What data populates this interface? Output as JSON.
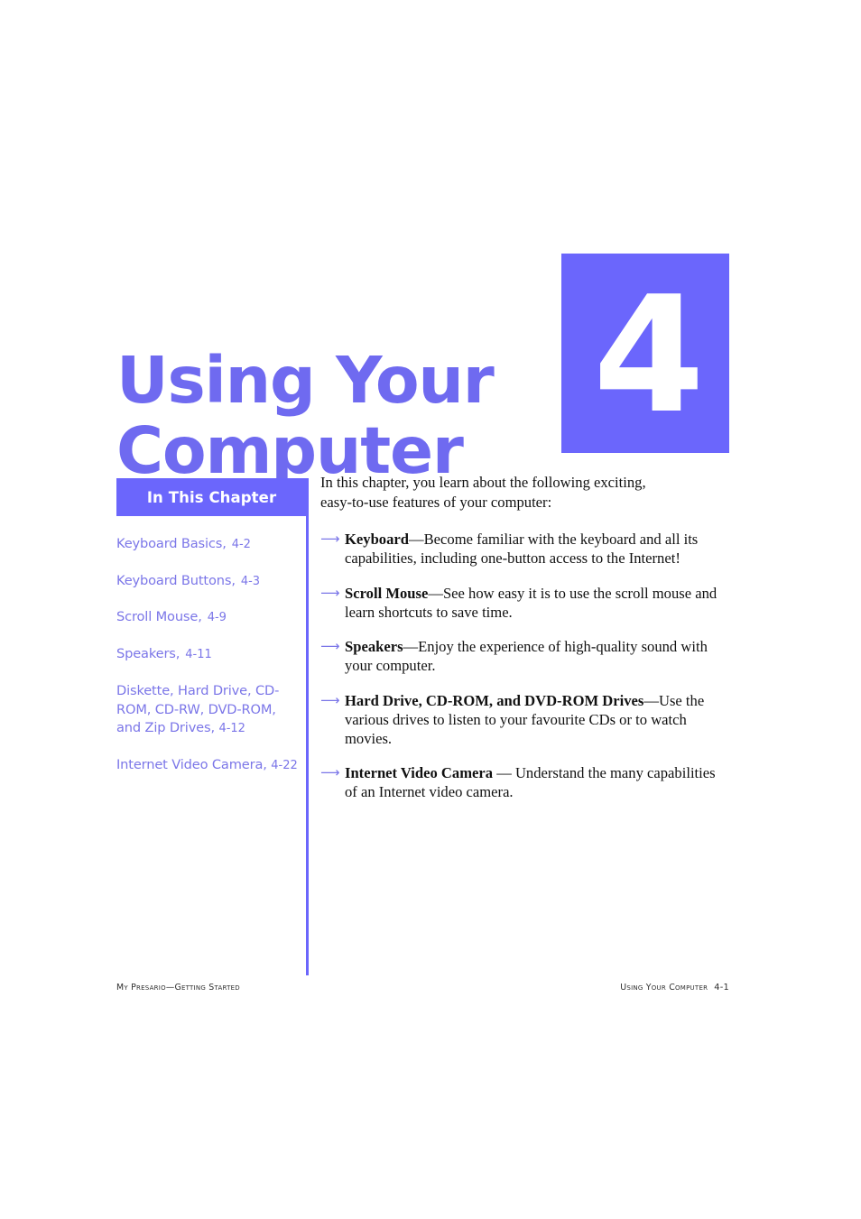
{
  "document": {
    "chapter_number": "4",
    "chapter_title_line1": "Using Your",
    "chapter_title_line2": "Computer",
    "accent_color": "#6b66fc",
    "title_color": "#6f6af0",
    "link_color": "#7b76e8"
  },
  "sidebar": {
    "header_label": "In This Chapter",
    "items": [
      {
        "label": "Keyboard Basics,",
        "page": "4-2"
      },
      {
        "label": "Keyboard Buttons,",
        "page": "4-3"
      },
      {
        "label": "Scroll Mouse,",
        "page": "4-9"
      },
      {
        "label": "Speakers,",
        "page": "4-11"
      },
      {
        "label": "Diskette, Hard Drive, CD-ROM, CD-RW, DVD-ROM, and Zip Drives,",
        "page": "4-12"
      },
      {
        "label": "Internet Video Camera,",
        "page": "4-22"
      }
    ]
  },
  "main": {
    "intro_line1": "In this chapter, you learn about the following exciting,",
    "intro_line2": "easy-to-use features of your computer:",
    "bullet_icon": "arrow-right-icon",
    "bullets": [
      {
        "term": "Keyboard",
        "text": "—Become familiar with the keyboard and all its capabilities, including one-button access to the Internet!"
      },
      {
        "term": "Scroll Mouse",
        "text": "—See how easy it is to use the scroll mouse and learn shortcuts to save time."
      },
      {
        "term": "Speakers",
        "text": "—Enjoy the experience of high-quality sound with your computer."
      },
      {
        "term": "Hard Drive, CD-ROM, and DVD-ROM Drives",
        "text": "—Use the various drives to listen to your favourite CDs or to watch movies."
      },
      {
        "term": "Internet Video Camera",
        "text": " — Understand the many capabilities of an Internet video camera."
      }
    ]
  },
  "footer": {
    "left": "My Presario—Getting Started",
    "right_title": "Using Your Computer",
    "right_page": "4-1"
  }
}
